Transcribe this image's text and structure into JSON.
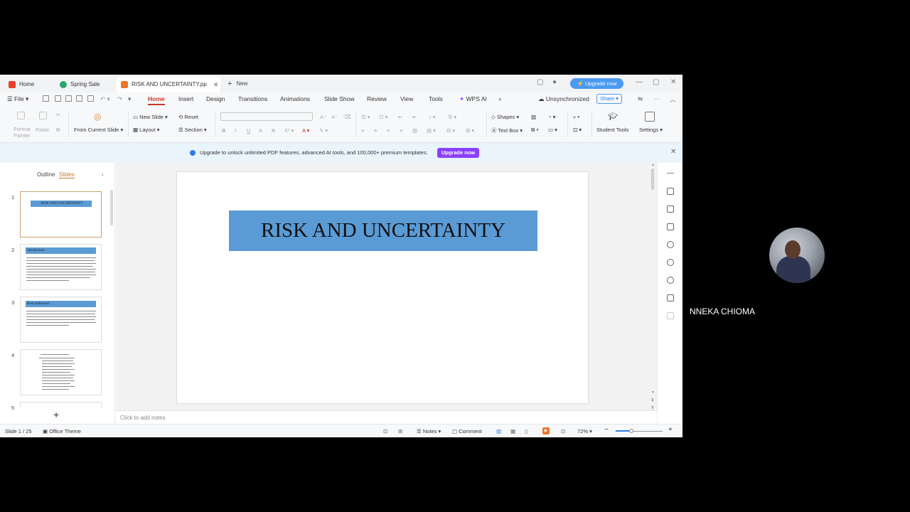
{
  "tabs": [
    {
      "label": "Home",
      "color": "#e8412c"
    },
    {
      "label": "Spring Sale",
      "color": "#2aa86a"
    },
    {
      "label": "RISK AND UNCERTAINTY.pp",
      "color": "#e8762c"
    }
  ],
  "new_tab_label": "New",
  "upgrade_pill": "Upgrade now",
  "menu": {
    "file": "File",
    "items": [
      "Home",
      "Insert",
      "Design",
      "Transitions",
      "Animations",
      "Slide Show",
      "Review",
      "View",
      "Tools",
      "WPS AI"
    ],
    "sync_status": "Unsynchronized",
    "share": "Share"
  },
  "ribbon": {
    "format_painter": "Format Painter",
    "paste": "Paste",
    "from_current_slide": "From Current Slide",
    "new_slide": "New Slide",
    "layout": "Layout",
    "reset": "Reset",
    "section": "Section",
    "shapes": "Shapes",
    "text_box": "Text Box",
    "student_tools": "Student Tools",
    "settings": "Settings"
  },
  "banner": {
    "text": "Upgrade to unlock unlimited PDF features, advanced AI tools, and 100,000+ premium templates.",
    "button": "Upgrade now"
  },
  "panel": {
    "outline": "Outline",
    "slides": "Slides"
  },
  "thumbnails": [
    {
      "num": "1",
      "title": "RISK AND UNCERTAINTY"
    },
    {
      "num": "2",
      "title": "Introduction"
    },
    {
      "num": "3",
      "title": "Risk preference"
    },
    {
      "num": "4",
      "title": ""
    },
    {
      "num": "5",
      "title": ""
    }
  ],
  "slide": {
    "title": "RISK AND UNCERTAINTY"
  },
  "notes_placeholder": "Click to add notes",
  "status": {
    "slide_counter": "Slide 1 / 25",
    "theme": "Office Theme",
    "notes": "Notes",
    "comment": "Comment",
    "zoom": "72%",
    "zoom_fraction": 0.33
  },
  "participant": {
    "name": "NNEKA CHIOMA"
  }
}
